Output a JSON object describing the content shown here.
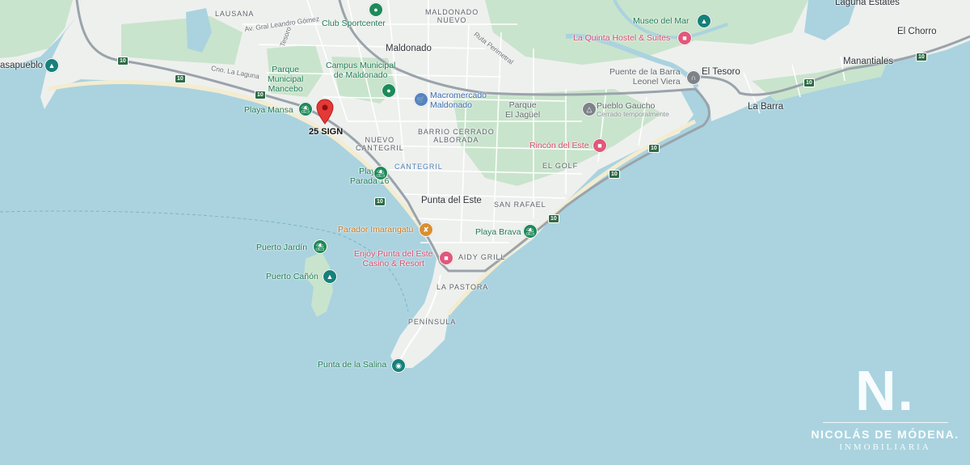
{
  "map": {
    "colors": {
      "water": "#aad3df",
      "land": "#eef0ee",
      "park": "#c9e4cc",
      "road": "#ffffff",
      "highway": "#9aa3ab",
      "beach": "#f4ecd0"
    },
    "selected_pin": {
      "label": "25 SIGN",
      "icon": "map-pin-icon",
      "color": "#e53935"
    },
    "route_shields": [
      "10",
      "10",
      "10",
      "10",
      "10",
      "10",
      "10",
      "10",
      "10"
    ],
    "areas": {
      "lausana": "LAUSANA",
      "maldonado_nuevo": "MALDONADO\nNUEVO",
      "nuevo_cantegril": "NUEVO\nCANTEGRIL",
      "barrio_cerrado": "BARRIO CERRADO\nALBORADA",
      "cantegril": "CANTEGRIL",
      "el_golf": "EL GOLF",
      "san_rafael": "SAN RAFAEL",
      "aidy_grill": "AIDY GRILL",
      "la_pastora": "LA PASTORA",
      "peninsula": "PENÍNSULA"
    },
    "cities": {
      "maldonado": "Maldonado",
      "punta_del_este": "Punta del Este",
      "el_tesoro": "El Tesoro",
      "la_barra": "La Barra",
      "manantiales": "Manantiales",
      "el_chorro": "El Chorro",
      "laguna_estates": "Laguna Estates",
      "casapueblo": "asapueblo"
    },
    "streets": {
      "leandro_gomez": "Av. Gral Leandro Gómez",
      "cno_laguna": "Cno. La Laguna",
      "ruta_perimetral": "Ruta Perimetral",
      "tesoro": "Tesoro"
    },
    "pois": {
      "club_sportcenter": "Club Sportcenter",
      "parque_mancebo": "Parque\nMunicipal\nMancebo",
      "campus_municipal": "Campus Municipal\nde Maldonado",
      "macromercado": "Macromercado\nMaldonado",
      "playa_mansa": "Playa Mansa",
      "parque_jaguel": "Parque\nEl Jagüel",
      "pueblo_gaucho": "Pueblo Gaucho",
      "pueblo_gaucho_status": "Cerrado temporalmente",
      "rincon_del_este": "Rincón del Este",
      "museo_del_mar": "Museo del Mar",
      "la_quinta": "La Quinta Hostel & Suites",
      "puente_barra": "Puente de la Barra\nLeonel Viera",
      "playa_parada16": "Playa\nParada 16",
      "parador_imarangatu": "Parador Imarangatú",
      "enjoy": "Enjoy Punta del Este\nCasino & Resort",
      "playa_brava": "Playa Brava",
      "puerto_jardin": "Puerto Jardín",
      "puerto_canon": "Puerto Cañón",
      "punta_salina": "Punta de la Salina"
    }
  },
  "brand": {
    "mark": "N.",
    "name": "NICOLÁS DE MÓDENA.",
    "subtitle": "INMOBILIARIA"
  }
}
